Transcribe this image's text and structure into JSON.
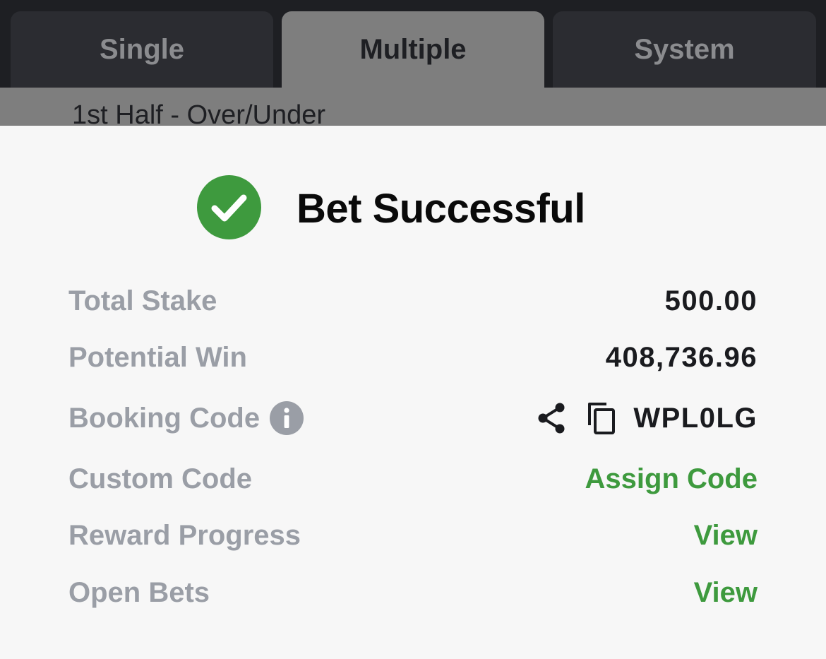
{
  "tabs": {
    "single": "Single",
    "multiple": "Multiple",
    "system": "System"
  },
  "market": {
    "label": "1st Half - Over/Under"
  },
  "success": {
    "title": "Bet Successful",
    "icon": "check-circle-icon",
    "accent_color": "#3e9a3e"
  },
  "rows": {
    "total_stake": {
      "label": "Total Stake",
      "value": "500.00"
    },
    "potential_win": {
      "label": "Potential Win",
      "value": "408,736.96"
    },
    "booking_code": {
      "label": "Booking Code",
      "value": "WPL0LG"
    },
    "custom_code": {
      "label": "Custom Code",
      "action": "Assign Code"
    },
    "reward_progress": {
      "label": "Reward Progress",
      "action": "View"
    },
    "open_bets": {
      "label": "Open Bets",
      "action": "View"
    }
  }
}
